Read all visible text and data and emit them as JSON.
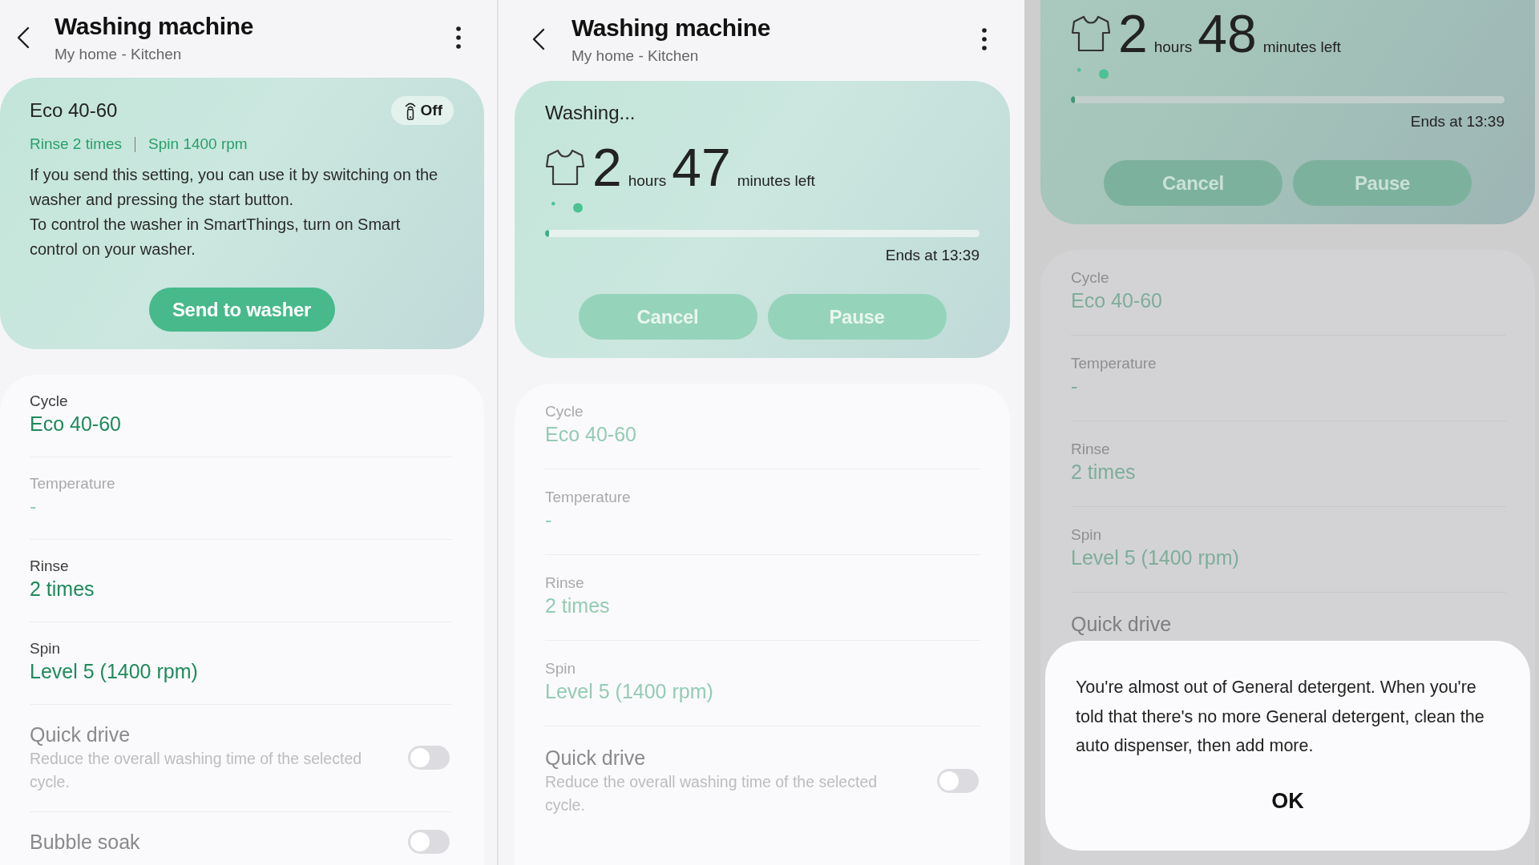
{
  "screens": [
    {
      "header": {
        "title": "Washing machine",
        "subtitle": "My home - Kitchen"
      },
      "status_card": {
        "kind": "setting",
        "program": "Eco 40-60",
        "remote_control": {
          "label": "Off"
        },
        "options": [
          "Rinse 2 times",
          "Spin 1400 rpm"
        ],
        "description": [
          "If you send this setting, you can use it by switching on the washer and pressing the start button.",
          "To control the washer in SmartThings, turn on Smart control on your washer."
        ],
        "buttons": [
          {
            "label": "Send to washer",
            "disabled": false
          }
        ]
      },
      "settings": [
        {
          "kind": "value",
          "label": "Cycle",
          "value": "Eco 40-60",
          "disabled": false
        },
        {
          "kind": "value",
          "label": "Temperature",
          "value": "-",
          "disabled": true
        },
        {
          "kind": "value",
          "label": "Rinse",
          "value": "2 times",
          "disabled": false
        },
        {
          "kind": "value",
          "label": "Spin",
          "value": "Level 5 (1400 rpm)",
          "disabled": false
        },
        {
          "kind": "toggle",
          "label": "Quick drive",
          "description": "Reduce the overall washing time of the selected cycle.",
          "on": false,
          "disabled": true
        },
        {
          "kind": "toggle",
          "label": "Bubble soak",
          "on": false,
          "disabled": true
        }
      ]
    },
    {
      "header": {
        "title": "Washing machine",
        "subtitle": "My home - Kitchen"
      },
      "status_card": {
        "kind": "running",
        "status": "Washing...",
        "remaining": {
          "hours": "2",
          "hours_unit": "hours",
          "minutes": "47",
          "minutes_unit": "minutes left"
        },
        "progress": {
          "level": 0.01
        },
        "ends": "Ends at 13:39",
        "buttons": [
          {
            "label": "Cancel",
            "disabled": true
          },
          {
            "label": "Pause",
            "disabled": true
          }
        ]
      },
      "settings": [
        {
          "kind": "value",
          "label": "Cycle",
          "value": "Eco 40-60",
          "disabled": true
        },
        {
          "kind": "value",
          "label": "Temperature",
          "value": "-",
          "disabled": true
        },
        {
          "kind": "value",
          "label": "Rinse",
          "value": "2 times",
          "disabled": true
        },
        {
          "kind": "value",
          "label": "Spin",
          "value": "Level 5 (1400 rpm)",
          "disabled": true
        },
        {
          "kind": "toggle",
          "label": "Quick drive",
          "description": "Reduce the overall washing time of the selected cycle.",
          "on": false,
          "disabled": true
        }
      ]
    },
    {
      "status_card": {
        "kind": "running",
        "remaining": {
          "hours": "2",
          "hours_unit": "hours",
          "minutes": "48",
          "minutes_unit": "minutes left"
        },
        "progress": {
          "level": 0.01
        },
        "ends": "Ends at 13:39",
        "buttons": [
          {
            "label": "Cancel",
            "disabled": true
          },
          {
            "label": "Pause",
            "disabled": true
          }
        ]
      },
      "settings": [
        {
          "kind": "value",
          "label": "Cycle",
          "value": "Eco 40-60",
          "disabled": true
        },
        {
          "kind": "value",
          "label": "Temperature",
          "value": "-",
          "disabled": true
        },
        {
          "kind": "value",
          "label": "Rinse",
          "value": "2 times",
          "disabled": true
        },
        {
          "kind": "value",
          "label": "Spin",
          "value": "Level 5 (1400 rpm)",
          "disabled": true
        },
        {
          "kind": "toggle",
          "label": "Quick drive",
          "disabled": true
        }
      ],
      "dialog": {
        "message": "You're almost out of General detergent. When you're told that there's no more General detergent, clean the auto dispenser, then add more.",
        "buttons": [
          "OK"
        ]
      }
    }
  ]
}
